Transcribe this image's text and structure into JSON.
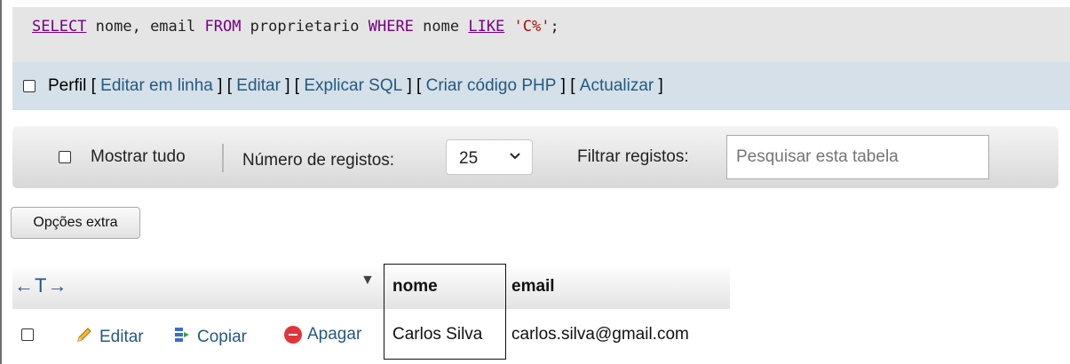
{
  "sql": {
    "select_kw": "SELECT",
    "cols": " nome, email ",
    "from_kw": "FROM",
    "table": " proprietario ",
    "where_kw": "WHERE",
    "field": " nome ",
    "like_kw": "LIKE",
    "space": " ",
    "pattern": "'C%'",
    "end": ";"
  },
  "profile_bar": {
    "label": "Perfil",
    "open": "[",
    "close": "]",
    "links": [
      "Editar em linha",
      "Editar",
      "Explicar SQL",
      "Criar código PHP",
      "Actualizar"
    ]
  },
  "nav": {
    "show_all": "Mostrar tudo",
    "num_rows_label": "Número de registos:",
    "num_rows_value": "25",
    "filter_label": "Filtrar registos:",
    "filter_placeholder": "Pesquisar esta tabela"
  },
  "extra_options": "Opções extra",
  "table": {
    "arrows": "←T→",
    "sort_icon": "▼",
    "columns": [
      "nome",
      "email"
    ],
    "rows": [
      {
        "actions": [
          "Editar",
          "Copiar",
          "Apagar"
        ],
        "nome": "Carlos Silva",
        "email": "carlos.silva@gmail.com"
      }
    ]
  },
  "icons": [
    "pencil-icon",
    "copy-icon",
    "delete-icon",
    "chevron-down-icon"
  ],
  "colors": {
    "link": "#235a81",
    "keyword": "#770088",
    "string": "#aa1111",
    "profile_bg": "#d5e0e8"
  }
}
